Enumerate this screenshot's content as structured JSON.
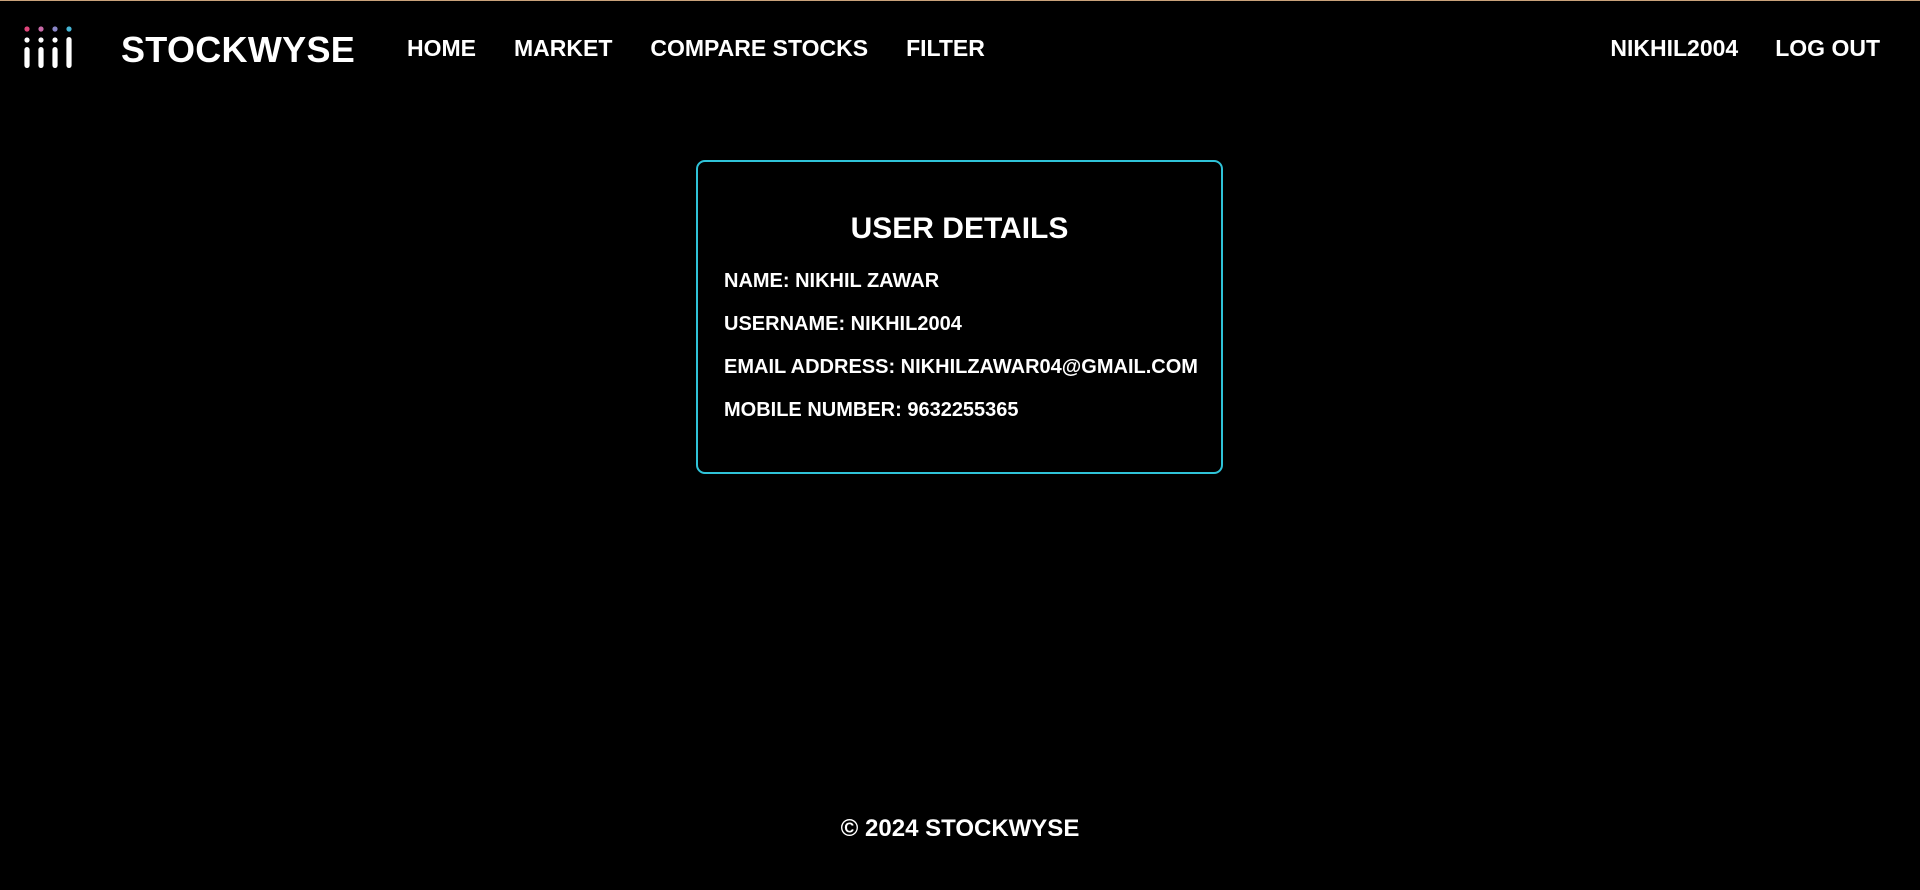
{
  "brand": {
    "name": "STOCKWYSE",
    "logo_icon": "bar-dots-logo-icon",
    "logo_dot_colors": [
      "#e0457b",
      "#c86aa8",
      "#8a86c8",
      "#46b6d6"
    ]
  },
  "nav": {
    "items": [
      "HOME",
      "MARKET",
      "COMPARE STOCKS",
      "FILTER"
    ],
    "username": "NIKHIL2004",
    "logout_label": "LOG OUT"
  },
  "card": {
    "title": "USER DETAILS",
    "name_line": "NAME: NIKHIL ZAWAR",
    "username_line": "USERNAME: NIKHIL2004",
    "email_line": "EMAIL ADDRESS: NIKHILZAWAR04@GMAIL.COM",
    "mobile_line": "MOBILE NUMBER: 9632255365",
    "border_color": "#2fc3d8"
  },
  "footer": {
    "text": "© 2024 STOCKWYSE"
  },
  "colors": {
    "background": "#000000",
    "text": "#ffffff",
    "accent": "#2fc3d8"
  }
}
